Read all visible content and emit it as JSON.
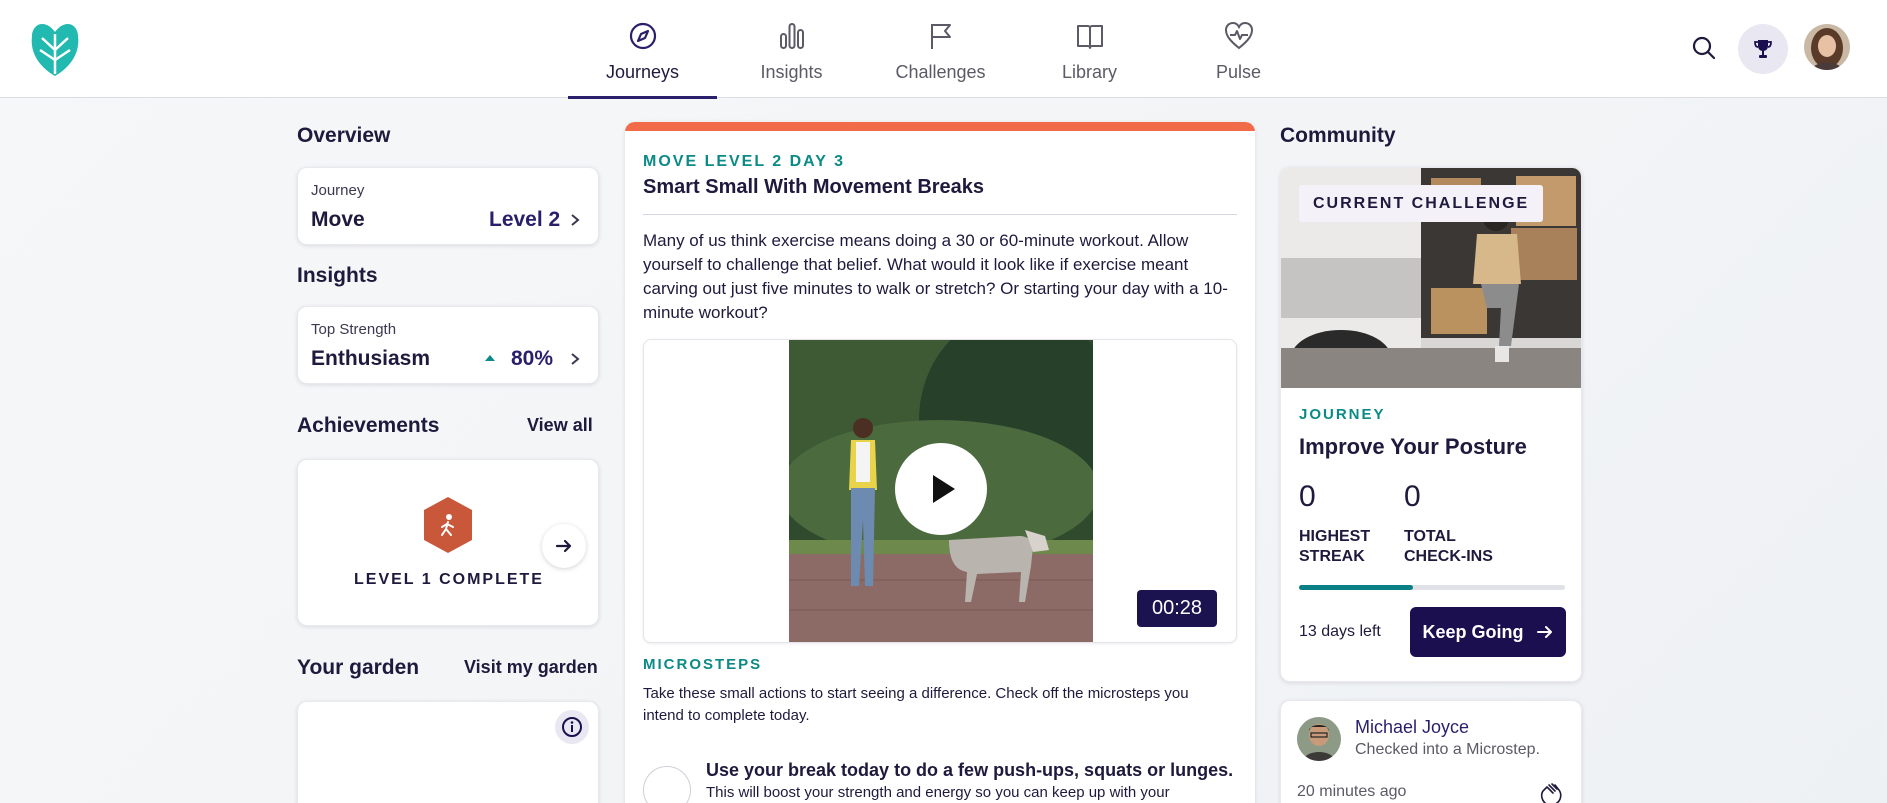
{
  "nav": {
    "items": [
      {
        "label": "Journeys",
        "icon": "compass-icon",
        "active": true
      },
      {
        "label": "Insights",
        "icon": "bar-chart-icon"
      },
      {
        "label": "Challenges",
        "icon": "flag-icon"
      },
      {
        "label": "Library",
        "icon": "book-icon"
      },
      {
        "label": "Pulse",
        "icon": "heartbeat-icon"
      }
    ]
  },
  "colors": {
    "brand": "#1b0f4f",
    "accent_teal": "#0b8a86",
    "accent_orange": "#f26b48",
    "badge_orange": "#c9583a"
  },
  "overview": {
    "title": "Overview",
    "journey_label": "Journey",
    "journey_value": "Move",
    "journey_level": "Level 2"
  },
  "insights": {
    "title": "Insights",
    "label": "Top Strength",
    "value": "Enthusiasm",
    "percent": "80%"
  },
  "achievements": {
    "title": "Achievements",
    "view_all": "View all",
    "badge_label": "LEVEL 1 COMPLETE",
    "badge_icon": "walking-person-icon"
  },
  "garden": {
    "title": "Your garden",
    "visit_link": "Visit my garden"
  },
  "lesson": {
    "eyebrow": "MOVE LEVEL 2 DAY 3",
    "title": "Smart Small With Movement Breaks",
    "body": "Many of us think exercise means doing a 30 or 60-minute workout. Allow yourself to challenge that belief. What would it look like if exercise meant carving out just five minutes to walk or stretch? Or starting your day with a 10-minute workout?",
    "video_duration": "00:28",
    "microsteps_title": "MICROSTEPS",
    "microsteps_desc": "Take these small actions to start seeing a difference. Check off the microsteps you intend to complete today.",
    "microstep_title": "Use your break today to do a few push-ups, squats or lunges.",
    "microstep_text": "This will boost your strength and energy so you can keep up with your"
  },
  "community": {
    "title": "Community",
    "challenge_tag": "CURRENT CHALLENGE",
    "journey_eyebrow": "JOURNEY",
    "journey_title": "Improve Your Posture",
    "highest_streak_value": "0",
    "highest_streak_label_1": "HIGHEST",
    "highest_streak_label_2": "STREAK",
    "total_checkins_value": "0",
    "total_checkins_label_1": "TOTAL",
    "total_checkins_label_2": "CHECK-INS",
    "progress_fraction": 0.43,
    "days_left": "13 days left",
    "cta": "Keep Going"
  },
  "activity": {
    "name": "Michael Joyce",
    "desc": "Checked into a Microstep.",
    "time": "20 minutes ago"
  }
}
